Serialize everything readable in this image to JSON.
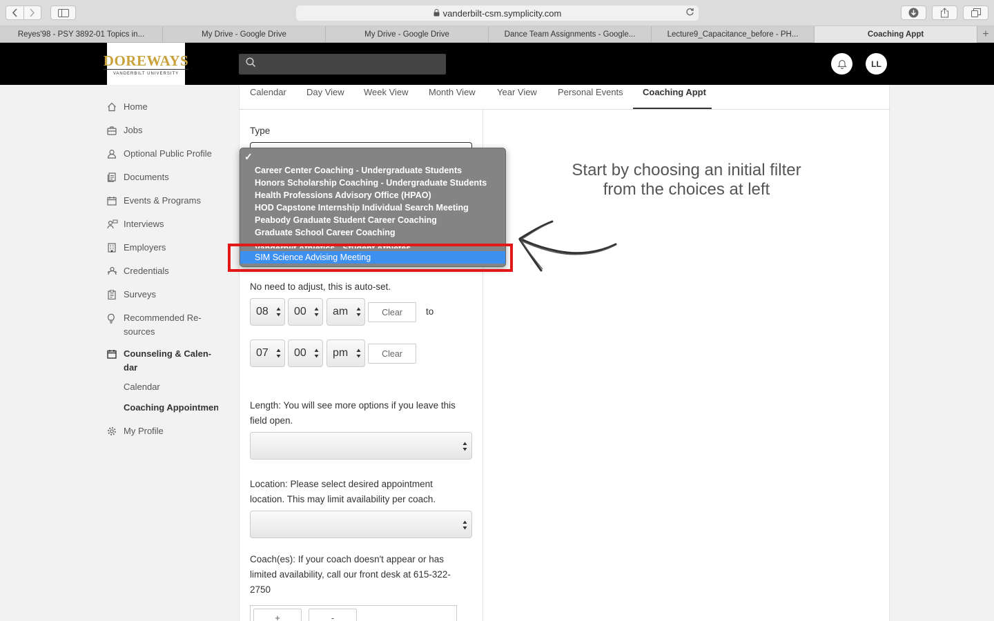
{
  "browser": {
    "url": "vanderbilt-csm.symplicity.com",
    "tabs": [
      {
        "label": "Reyes'98 - PSY 3892-01 Topics in..."
      },
      {
        "label": "My Drive - Google Drive"
      },
      {
        "label": "My Drive - Google Drive"
      },
      {
        "label": "Dance Team Assignments - Google..."
      },
      {
        "label": "Lecture9_Capacitance_before - PH..."
      },
      {
        "label": "Coaching Appt"
      }
    ]
  },
  "header": {
    "logo_title": "DOREWAYS",
    "logo_sub": "VANDERBILT UNIVERSITY",
    "user_initials": "LL"
  },
  "sidebar": {
    "items": [
      {
        "label": "Home",
        "icon": "home-icon"
      },
      {
        "label": "Jobs",
        "icon": "briefcase-icon"
      },
      {
        "label": "Optional Public Profile",
        "icon": "user-icon"
      },
      {
        "label": "Documents",
        "icon": "documents-icon"
      },
      {
        "label": "Events & Programs",
        "icon": "calendar-icon"
      },
      {
        "label": "Interviews",
        "icon": "interviews-icon"
      },
      {
        "label": "Employers",
        "icon": "building-icon"
      },
      {
        "label": "Credentials",
        "icon": "credentials-icon"
      },
      {
        "label": "Surveys",
        "icon": "clipboard-icon"
      },
      {
        "label": "Recommended Re-",
        "label2": "sources",
        "icon": "lightbulb-icon"
      },
      {
        "label": "Counseling & Calen-",
        "label2": "dar",
        "icon": "calendar-icon"
      },
      {
        "label": "My Profile",
        "icon": "gear-icon"
      }
    ],
    "sub_items": [
      {
        "label": "Calendar"
      },
      {
        "label": "Coaching Appointments"
      }
    ]
  },
  "tabs": [
    "Calendar",
    "Day View",
    "Week View",
    "Month View",
    "Year View",
    "Personal Events",
    "Coaching Appt"
  ],
  "form": {
    "type_label": "Type",
    "time_note": "No need to adjust, this is auto-set.",
    "start": {
      "hour": "08",
      "minute": "00",
      "ampm": "am"
    },
    "end": {
      "hour": "07",
      "minute": "00",
      "ampm": "pm"
    },
    "clear_label": "Clear",
    "to_label": "to",
    "length_label_1": "Length: You will see more options if you leave this",
    "length_label_2": "field open.",
    "location_label_1": "Location: Please select desired appointment",
    "location_label_2": "location. This may limit availability per coach.",
    "coach_label_1": "Coach(es): If your coach doesn't appear or has",
    "coach_label_2": "limited availability, call our front desk at 615-322-",
    "coach_label_3": "2750",
    "add_label": "+",
    "remove_label": "-"
  },
  "hint": "Start by choosing an initial filter from the choices at left",
  "dropdown": {
    "check": "✓",
    "options": [
      "Career Center Coaching - Undergraduate Students",
      "Honors Scholarship Coaching - Undergraduate Students",
      "Health Professions Advisory Office (HPAO)",
      "HOD Capstone Internship Individual Search Meeting",
      "Peabody Graduate Student Career Coaching",
      "Graduate School Career Coaching",
      "Vanderbilt Athletics - Student Athletes",
      "SIM Science Advising Meeting"
    ],
    "selected": "SIM Science Advising Meeting"
  },
  "colors": {
    "accent": "#3d8ff0",
    "highlight": "#e21818",
    "logo_gold": "#c9a13a"
  }
}
